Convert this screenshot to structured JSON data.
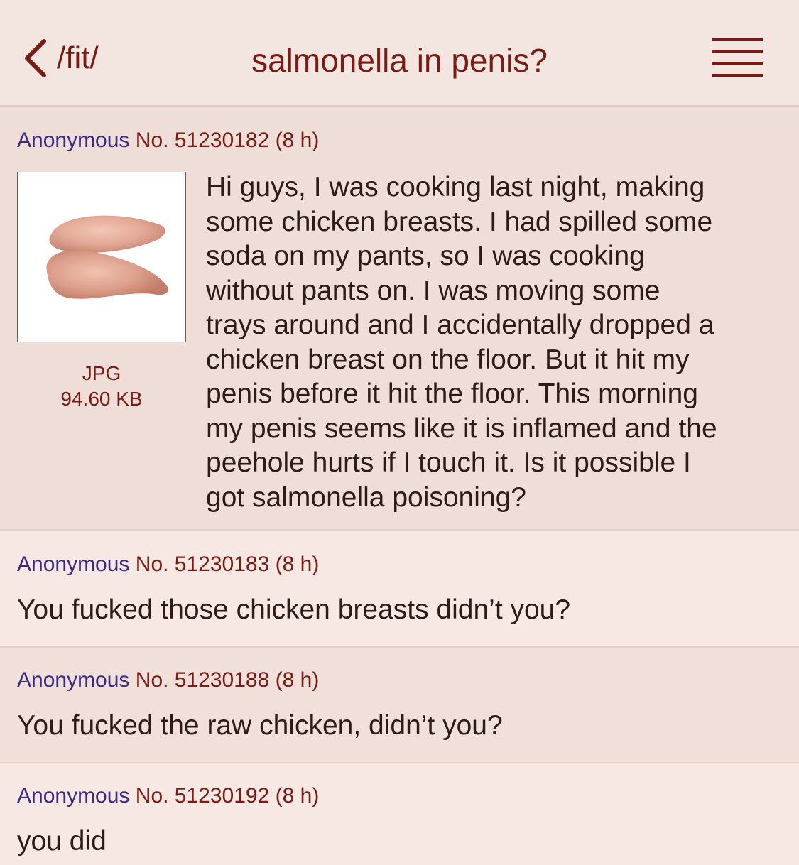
{
  "header": {
    "back_label": "/fit/",
    "title": "salmonella in penis?"
  },
  "posts": [
    {
      "name": "Anonymous",
      "number": "No. 51230182",
      "age": "(8 h)",
      "file_type": "JPG",
      "file_size": "94.60 KB",
      "lines": [
        "Hi guys, I was cooking last night, making",
        "some chicken breasts. I had spilled some",
        "soda on my pants, so I was cooking",
        "without pants on. I was moving some",
        "trays around and I accidentally dropped a",
        "chicken breast on the floor. But it hit my",
        "penis before it hit the floor. This morning",
        "my penis seems like it is inflamed and the",
        "peehole hurts if I touch it. Is it possible I",
        "got salmonella poisoning?"
      ]
    },
    {
      "name": "Anonymous",
      "number": "No. 51230183",
      "age": "(8 h)",
      "text": "You fucked those chicken breasts didn’t you?"
    },
    {
      "name": "Anonymous",
      "number": "No. 51230188",
      "age": "(8 h)",
      "text": "You fucked the raw chicken, didn’t you?"
    },
    {
      "name": "Anonymous",
      "number": "No. 51230192",
      "age": "(8 h)",
      "text": "you did"
    }
  ],
  "colors": {
    "accent": "#7a1b16",
    "name": "#3b2a83",
    "background": "#f5e6e1"
  },
  "icons": {
    "back": "chevron-left-icon",
    "menu": "hamburger-menu-icon",
    "thumbnail": "chicken-breast-thumbnail"
  }
}
